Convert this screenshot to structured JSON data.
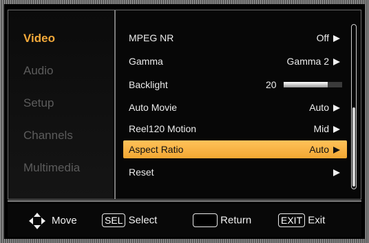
{
  "sidebar": {
    "items": [
      {
        "label": "Video",
        "active": true
      },
      {
        "label": "Audio",
        "active": false
      },
      {
        "label": "Setup",
        "active": false
      },
      {
        "label": "Channels",
        "active": false
      },
      {
        "label": "Multimedia",
        "active": false
      }
    ]
  },
  "menu": {
    "rows": [
      {
        "label": "MPEG NR",
        "value": "Off"
      },
      {
        "label": "Gamma",
        "value": "Gamma 2"
      },
      {
        "label": "Backlight",
        "value": "20",
        "slider_level": 0.75
      },
      {
        "label": "Auto Movie",
        "value": "Auto"
      },
      {
        "label": "Reel120 Motion",
        "value": "Mid"
      },
      {
        "label": "Aspect Ratio",
        "value": "Auto",
        "selected": true
      },
      {
        "label": "Reset",
        "value": ""
      }
    ]
  },
  "footer": {
    "move_label": "Move",
    "select_key": "SEL",
    "select_label": "Select",
    "return_label": "Return",
    "exit_key": "EXIT",
    "exit_label": "Exit"
  },
  "colors": {
    "accent": "#f2a93a",
    "highlight": "#f6b245",
    "inactive_text": "#5c5c5c",
    "text": "#ececec"
  },
  "icons": [
    "move-arrows-icon",
    "arrow-right-icon",
    "scrollbar"
  ]
}
